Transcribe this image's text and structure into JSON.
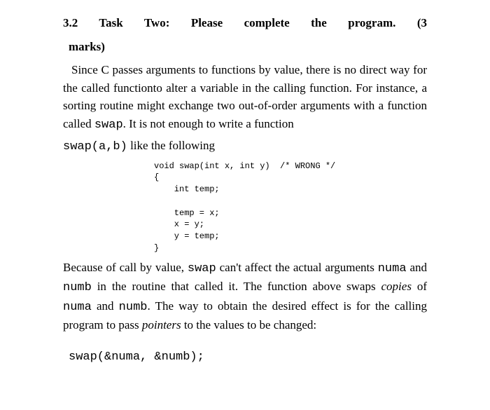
{
  "heading": {
    "part1": "3.2  Task  Two:",
    "part2": "Please  complete  the  program.",
    "part3": "(3",
    "line2": "marks)"
  },
  "para1": {
    "t1": "Since C passes arguments to functions by value, there is no direct way for the called functionto alter a variable in the calling function. For instance, a sorting routine might exchange two out-of-order arguments with a function called ",
    "code1": "swap",
    "t2": ". It is not enough to write a function"
  },
  "para1b": {
    "code": "swap(a,b)",
    "t": " like the following"
  },
  "codeblock": "void swap(int x, int y)  /* WRONG */\n{\n    int temp;\n\n    temp = x;\n    x = y;\n    y = temp;\n}",
  "para2": {
    "t1": "Because of call by value, ",
    "code1": "swap",
    "t2": "  can't affect the actual arguments ",
    "code2": "numa",
    "t3": "  and ",
    "code3": "numb",
    "t4": "  in the routine that called it. The function above swaps ",
    "em1": "copies",
    "t5": " of ",
    "code4": "numa",
    "t6": "  and ",
    "code5": "numb",
    "t7": ". The way to obtain the desired effect is for the calling program to pass ",
    "em2": "pointers",
    "t8": " to the values to be changed:"
  },
  "finalcode": "swap(&numa, &numb);"
}
